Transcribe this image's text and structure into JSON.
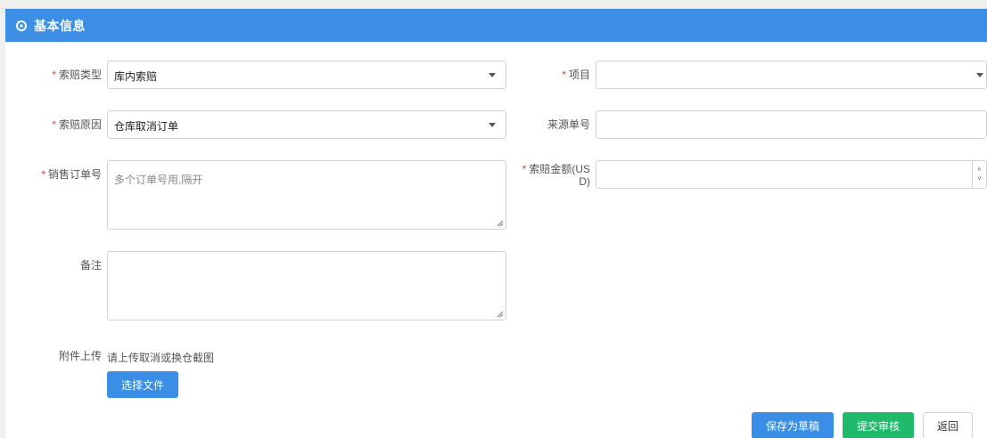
{
  "panel": {
    "title": "基本信息"
  },
  "form": {
    "claim_type": {
      "label": "索赔类型",
      "value": "库内索赔",
      "required": "*"
    },
    "project": {
      "label": "项目",
      "value": "",
      "required": "*"
    },
    "claim_reason": {
      "label": "索赔原因",
      "value": "仓库取消订单",
      "required": "*"
    },
    "source_order": {
      "label": "来源单号",
      "value": ""
    },
    "sales_order": {
      "label": "销售订单号",
      "placeholder": "多个订单号用,隔开",
      "required": "*"
    },
    "claim_amount": {
      "label_line1": "索赔金额(US",
      "label_line2": "D)",
      "value": "",
      "required": "*",
      "up": "˄",
      "down": "˅"
    },
    "remark": {
      "label": "备注",
      "value": ""
    },
    "attachment": {
      "label": "附件上传",
      "hint": "请上传取消或换仓截图",
      "button": "选择文件"
    }
  },
  "actions": {
    "save_draft": "保存为草稿",
    "submit": "提交审核",
    "back": "返回"
  }
}
